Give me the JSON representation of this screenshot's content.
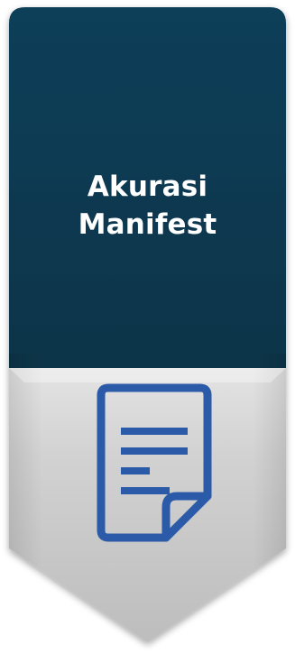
{
  "card": {
    "title_line_1": "Akurasi",
    "title_line_2": "Manifest",
    "icon": "document-icon",
    "colors": {
      "header_bg": "#0e3a52",
      "footer_bg": "#cfcfcf",
      "icon_stroke": "#2a5aa8",
      "title_text": "#ffffff"
    }
  }
}
